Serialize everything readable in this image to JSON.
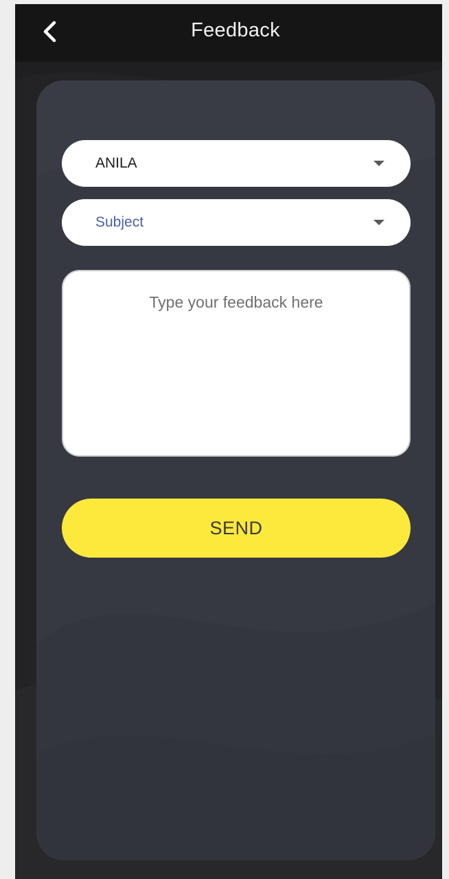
{
  "header": {
    "title": "Feedback",
    "back_icon": "chevron-left-icon"
  },
  "form": {
    "user_select": {
      "value": "ANILA",
      "icon": "caret-down-icon"
    },
    "subject_select": {
      "placeholder": "Subject",
      "icon": "caret-down-icon"
    },
    "feedback": {
      "placeholder": "Type your feedback here",
      "value": ""
    },
    "send_label": "SEND"
  },
  "colors": {
    "app_bar": "#151516",
    "background": "#1f1f21",
    "card": "#363942",
    "send_button": "#fde93c",
    "placeholder_subject": "#4b5fa6"
  }
}
